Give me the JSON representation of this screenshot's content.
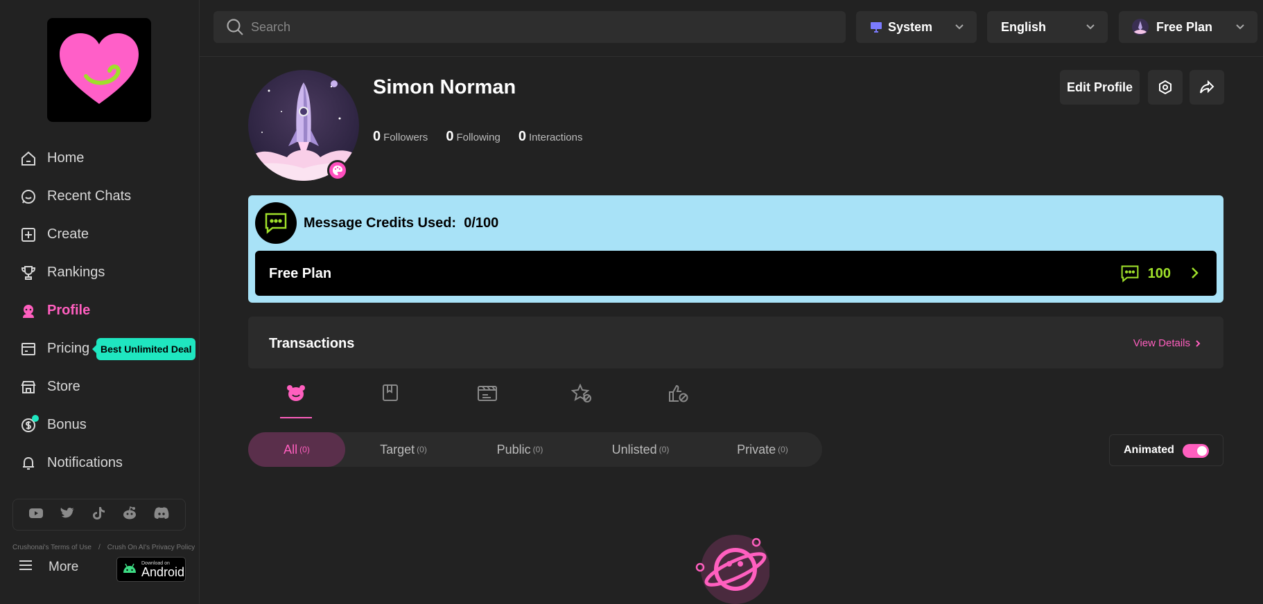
{
  "sidebar": {
    "items": [
      {
        "label": "Home",
        "icon": "home-icon"
      },
      {
        "label": "Recent Chats",
        "icon": "chat-icon"
      },
      {
        "label": "Create",
        "icon": "plus-square-icon"
      },
      {
        "label": "Rankings",
        "icon": "trophy-icon"
      },
      {
        "label": "Profile",
        "icon": "user-icon"
      },
      {
        "label": "Pricing",
        "icon": "card-icon"
      },
      {
        "label": "Store",
        "icon": "store-icon"
      },
      {
        "label": "Bonus",
        "icon": "dollar-icon"
      },
      {
        "label": "Notifications",
        "icon": "bell-icon"
      }
    ],
    "pricing_badge": "Best Unlimited Deal",
    "legal": {
      "terms": "Crushonai's Terms of Use",
      "separator": "/",
      "privacy": "Crush On AI's Privacy Policy"
    },
    "more_label": "More",
    "android": {
      "small": "Download on",
      "big": "Android"
    }
  },
  "topbar": {
    "search_placeholder": "Search",
    "theme": "System",
    "language": "English",
    "plan": "Free Plan"
  },
  "profile": {
    "name": "Simon Norman",
    "followers": {
      "count": "0",
      "label": "Followers"
    },
    "following": {
      "count": "0",
      "label": "Following"
    },
    "interactions": {
      "count": "0",
      "label": "Interactions"
    },
    "edit_label": "Edit Profile"
  },
  "credits": {
    "title": "Message Credits Used:",
    "value": "0/100",
    "plan_name": "Free Plan",
    "plan_count": "100"
  },
  "transactions": {
    "title": "Transactions",
    "view_details": "View Details"
  },
  "filters": [
    {
      "label": "All",
      "count": "(0)"
    },
    {
      "label": "Target",
      "count": "(0)"
    },
    {
      "label": "Public",
      "count": "(0)"
    },
    {
      "label": "Unlisted",
      "count": "(0)"
    },
    {
      "label": "Private",
      "count": "(0)"
    }
  ],
  "animated_label": "Animated",
  "colors": {
    "accent": "#ff5fbf",
    "lime": "#9fe02a",
    "teal": "#1fe6c0",
    "credits_bg": "#a8e2f7"
  }
}
